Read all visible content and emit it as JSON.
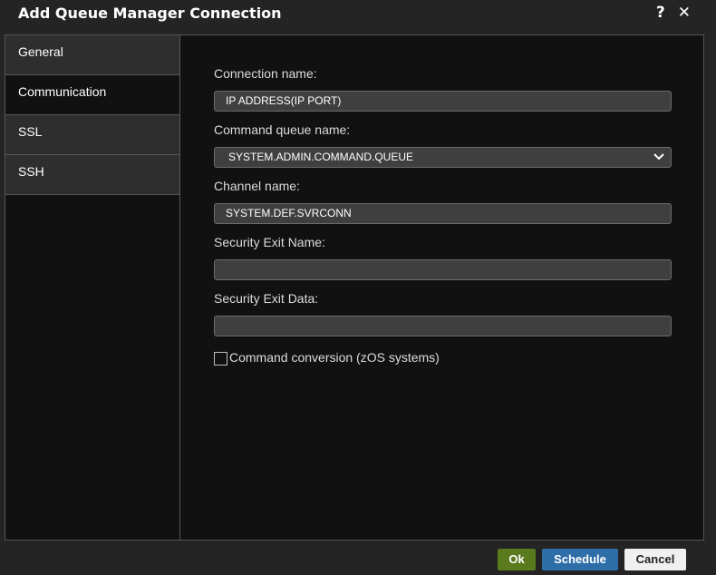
{
  "dialog": {
    "title": "Add Queue Manager Connection",
    "help_icon": "?",
    "close_icon": "✕"
  },
  "tabs": [
    {
      "label": "General",
      "active": false
    },
    {
      "label": "Communication",
      "active": true
    },
    {
      "label": "SSL",
      "active": false
    },
    {
      "label": "SSH",
      "active": false
    }
  ],
  "form": {
    "connection_name_label": "Connection name:",
    "connection_name_value": "IP ADDRESS(IP PORT)",
    "command_queue_label": "Command queue name:",
    "command_queue_value": "SYSTEM.ADMIN.COMMAND.QUEUE",
    "channel_name_label": "Channel name:",
    "channel_name_value": "SYSTEM.DEF.SVRCONN",
    "security_exit_name_label": "Security Exit Name:",
    "security_exit_name_value": "",
    "security_exit_data_label": "Security Exit Data:",
    "security_exit_data_value": "",
    "command_conversion_label": "Command conversion (zOS systems)",
    "command_conversion_checked": false
  },
  "buttons": {
    "ok": "Ok",
    "schedule": "Schedule",
    "cancel": "Cancel"
  },
  "colors": {
    "ok": "#5a7a1e",
    "schedule": "#2e6ea8",
    "cancel": "#f0f0f0"
  }
}
